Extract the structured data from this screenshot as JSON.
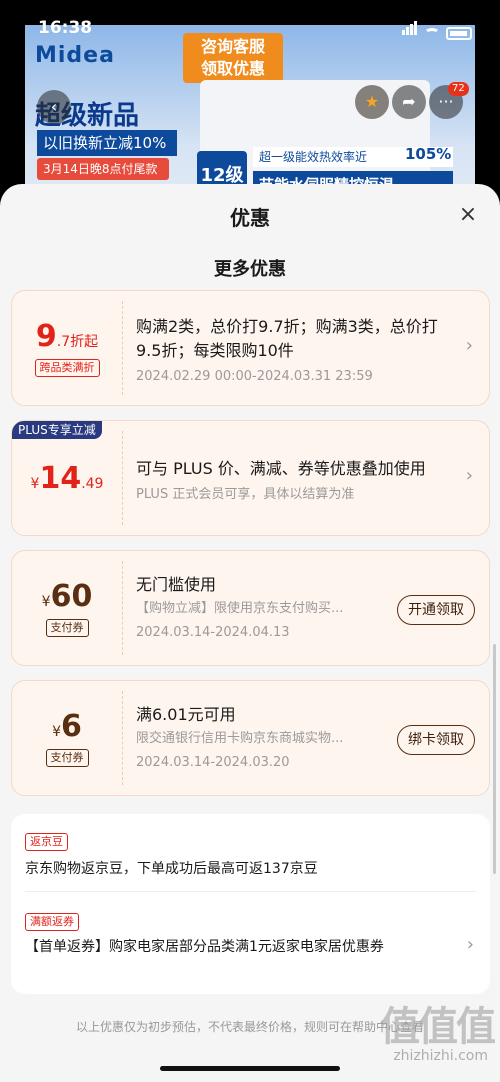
{
  "status_bar": {
    "time": "16:38"
  },
  "banner": {
    "brand": "Midea",
    "consult_line1": "咨询客服",
    "consult_line2": "领取优惠",
    "new_title": "超级新品",
    "tradein": "以旧换新立减10%",
    "date_badge": "3月14日晚8点付尾款",
    "grade": "12级",
    "efficiency": "超一级能效热效率近",
    "efficiency_pct": "105%",
    "feature": "节能水伺服精控恒温",
    "more_badge": "72"
  },
  "sheet": {
    "title": "优惠",
    "section_title": "更多优惠",
    "offers": [
      {
        "value_big": "9",
        "value_small": ".7折起",
        "tag": "跨品类满折",
        "text": "购满2类，总价打9.7折；购满3类，总价打9.5折；每类限购10件",
        "date": "2024.02.29 00:00-2024.03.31 23:59"
      },
      {
        "badge": "PLUS专享立减",
        "currency": "¥",
        "value_big": "14",
        "value_small": ".49",
        "text": "可与 PLUS 价、满减、券等优惠叠加使用",
        "sub": "PLUS 正式会员可享，具体以结算为准"
      },
      {
        "currency": "¥",
        "value_big": "60",
        "tag": "支付券",
        "text": "无门槛使用",
        "sub": "【购物立减】限使用京东支付购买...",
        "date": "2024.03.14-2024.04.13",
        "button": "开通领取"
      },
      {
        "currency": "¥",
        "value_big": "6",
        "tag": "支付券",
        "text": "满6.01元可用",
        "sub": "限交通银行信用卡购京东商城实物...",
        "date": "2024.03.14-2024.03.20",
        "button": "绑卡领取"
      }
    ],
    "bottom": [
      {
        "tag": "返京豆",
        "text": "京东购物返京豆，下单成功后最高可返137京豆"
      },
      {
        "tag": "满额返券",
        "text": "【首单返券】购家电家居部分品类满1元返家电家居优惠券"
      }
    ],
    "footer": "以上优惠仅为初步预估，不代表最终价格，规则可在帮助中心查看",
    "watermark": "值值值",
    "watermark_sub": "zhizhizhi.com"
  },
  "colors": {
    "accent_red": "#e2231a",
    "coupon_brown": "#5a2e10",
    "plus_navy": "#2a3a80"
  }
}
